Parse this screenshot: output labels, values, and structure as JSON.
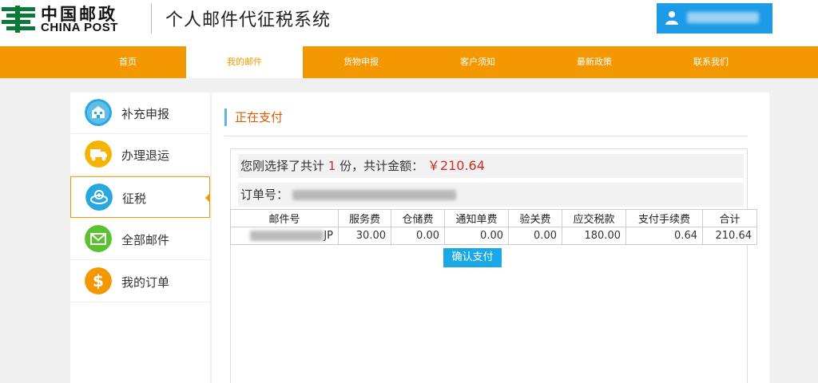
{
  "header": {
    "logo_cn": "中国邮政",
    "logo_en": "CHINA POST",
    "system_title": "个人邮件代征税系统"
  },
  "nav": {
    "items": [
      "首页",
      "我的邮件",
      "货物申报",
      "客户须知",
      "最新政策",
      "联系我们"
    ],
    "active_index": 1
  },
  "sidebar": {
    "items": [
      {
        "label": "补充申报",
        "icon": "building-icon",
        "color": "#29a8e0"
      },
      {
        "label": "办理退运",
        "icon": "truck-icon",
        "color": "#f5b400"
      },
      {
        "label": "征税",
        "icon": "tax-icon",
        "color": "#29a8e0"
      },
      {
        "label": "全部邮件",
        "icon": "mail-icon",
        "color": "#5bc130"
      },
      {
        "label": "我的订单",
        "icon": "dollar-icon",
        "color": "#f39800"
      }
    ],
    "active_index": 2
  },
  "main": {
    "section_title": "正在支付",
    "summary": {
      "prefix": "您刚选择了共计",
      "count": "1",
      "middle": "份，共计金额：",
      "amount": "￥210.64"
    },
    "order": {
      "label": "订单号："
    },
    "table": {
      "headers": [
        "邮件号",
        "服务费",
        "仓储费",
        "通知单费",
        "验关费",
        "应交税款",
        "支付手续费",
        "合计"
      ],
      "rows": [
        {
          "mail_suffix": "JP",
          "service": "30.00",
          "storage": "0.00",
          "notice": "0.00",
          "inspection": "0.00",
          "tax": "180.00",
          "handling": "0.64",
          "total": "210.64"
        }
      ]
    },
    "confirm_label": "确认支付"
  },
  "colors": {
    "nav_orange": "#f39800",
    "user_blue": "#1e9be8",
    "accent_blue": "#1aa9e6",
    "price_red": "#d52b1e",
    "title_orange": "#e05a00",
    "logo_green": "#0a7a3b"
  }
}
